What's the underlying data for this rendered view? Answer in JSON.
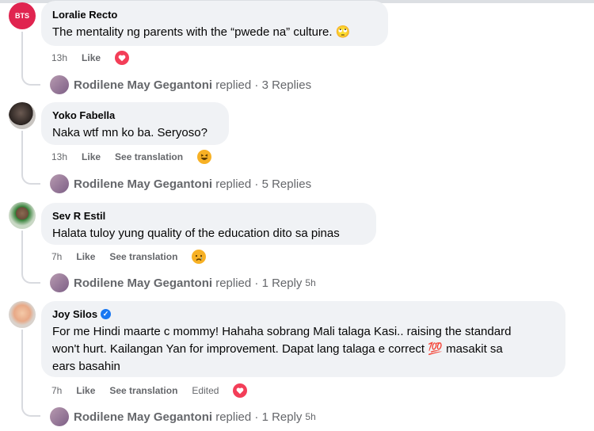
{
  "comments": [
    {
      "author": "Loralie Recto",
      "avatar_label": "BTS",
      "text": "The mentality ng parents with the “pwede na” culture. 🙄",
      "time": "13h",
      "like": "Like",
      "reaction": "heart-icon",
      "replies": {
        "replier": "Rodilene May Gegantoni",
        "label": "replied · 3 Replies"
      }
    },
    {
      "author": "Yoko Fabella",
      "text": "Naka wtf mn ko ba. Seryoso?",
      "time": "13h",
      "like": "Like",
      "see_translation": "See translation",
      "reaction": "laugh-icon",
      "replies": {
        "replier": "Rodilene May Gegantoni",
        "label": "replied · 5 Replies"
      }
    },
    {
      "author": "Sev R Estil",
      "text": "Halata tuloy yung quality of the education dito sa pinas",
      "time": "7h",
      "like": "Like",
      "see_translation": "See translation",
      "reaction": "sad-icon",
      "replies": {
        "replier": "Rodilene May Gegantoni",
        "label": "replied · 1 Reply",
        "time": "5h"
      }
    },
    {
      "author": "Joy Silos",
      "verified": "✓",
      "text_lines": [
        "For me Hindi maarte c mommy! Hahaha sobrang Mali talaga Kasi.. raising the standard",
        "won't hurt. Kailangan Yan for improvement. Dapat lang talaga e correct 💯 masakit sa",
        "ears basahin"
      ],
      "time": "7h",
      "like": "Like",
      "see_translation": "See translation",
      "edited": "Edited",
      "reaction": "heart-icon",
      "replies": {
        "replier": "Rodilene May Gegantoni",
        "label": "replied · 1 Reply",
        "time": "5h"
      }
    }
  ],
  "colors": {
    "bubble": "#f0f2f5",
    "meta": "#65676b",
    "heart": "#f33e58",
    "haha": "#f7b125"
  }
}
